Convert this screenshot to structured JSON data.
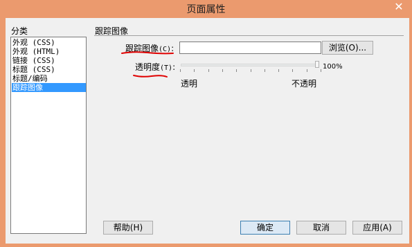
{
  "window": {
    "title": "页面属性",
    "close_glyph": "✕"
  },
  "categories": {
    "label": "分类",
    "items": [
      {
        "label": "外观 (CSS)",
        "selected": false
      },
      {
        "label": "外观 (HTML)",
        "selected": false
      },
      {
        "label": "链接 (CSS)",
        "selected": false
      },
      {
        "label": "标题 (CSS)",
        "selected": false
      },
      {
        "label": "标题/编码",
        "selected": false
      },
      {
        "label": "跟踪图像",
        "selected": true
      }
    ]
  },
  "panel": {
    "title": "跟踪图像",
    "tracing_image": {
      "label": "跟踪图像",
      "access_key": "(C)",
      "colon": ":",
      "value": "",
      "browse_label": "浏览(O)..."
    },
    "transparency": {
      "label": "透明度",
      "access_key": "(T)",
      "colon": ":",
      "value_text": "100%",
      "value_fraction": 1.0,
      "min_label": "透明",
      "max_label": "不透明"
    }
  },
  "buttons": {
    "help": "帮助(H)",
    "ok": "确定",
    "cancel": "取消",
    "apply": "应用(A)"
  },
  "colors": {
    "title_bar": "#EB9A6E",
    "selection": "#3399FF",
    "annotation": "#E00000"
  }
}
